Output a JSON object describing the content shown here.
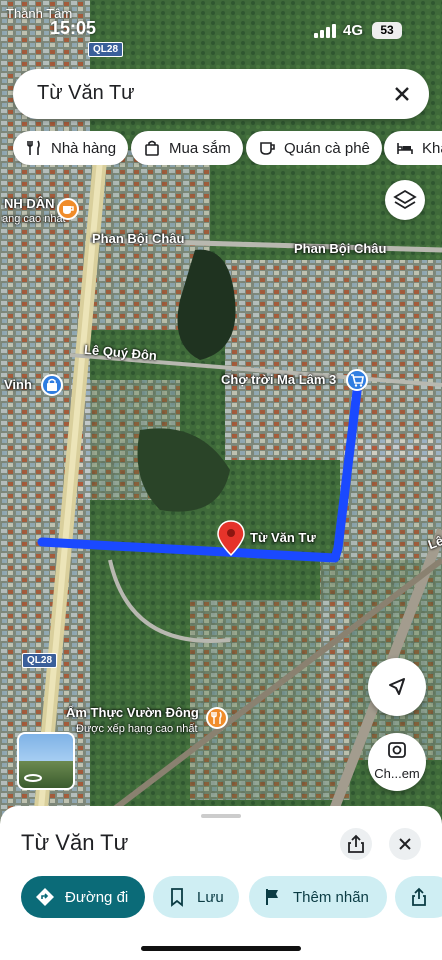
{
  "status_bar": {
    "time": "15:05",
    "network": "4G",
    "battery": "53",
    "carrier_label": "Thành Tâm"
  },
  "search": {
    "query": "Từ Văn Tư"
  },
  "chips": [
    {
      "label": "Nhà hàng",
      "icon": "fork-knife-icon"
    },
    {
      "label": "Mua sắm",
      "icon": "shopping-bag-icon"
    },
    {
      "label": "Quán cà phê",
      "icon": "coffee-icon"
    },
    {
      "label": "Khá",
      "icon": "bed-icon"
    }
  ],
  "map": {
    "labels": {
      "phan_boi_chau_left": "Phan Bội Châu",
      "phan_boi_chau_right": "Phan Bội Châu",
      "le_quy_don": "Lê Quý Đôn",
      "cho_troi": "Chợ trời Ma Lâm 3",
      "tu_van_tu": "Từ Văn Tư",
      "le_right": "Lê",
      "vinh": "Vinh",
      "dan": "NH DÂN",
      "dan_sub": "ạng cao nhất",
      "am_thuc": "Ẩm Thực Vườn Đông",
      "am_thuc_sub": "Được xếp hạng cao nhất",
      "route_top": "QL28",
      "route_bottom": "QL28"
    },
    "colors": {
      "route": "#1a49ff",
      "pin": "#e5332a"
    }
  },
  "buttons": {
    "lens_label": "Ch...em"
  },
  "sheet": {
    "title": "Từ Văn Tư",
    "actions": [
      {
        "label": "Đường đi",
        "icon": "directions-icon"
      },
      {
        "label": "Lưu",
        "icon": "bookmark-icon"
      },
      {
        "label": "Thêm nhãn",
        "icon": "flag-icon"
      }
    ]
  }
}
